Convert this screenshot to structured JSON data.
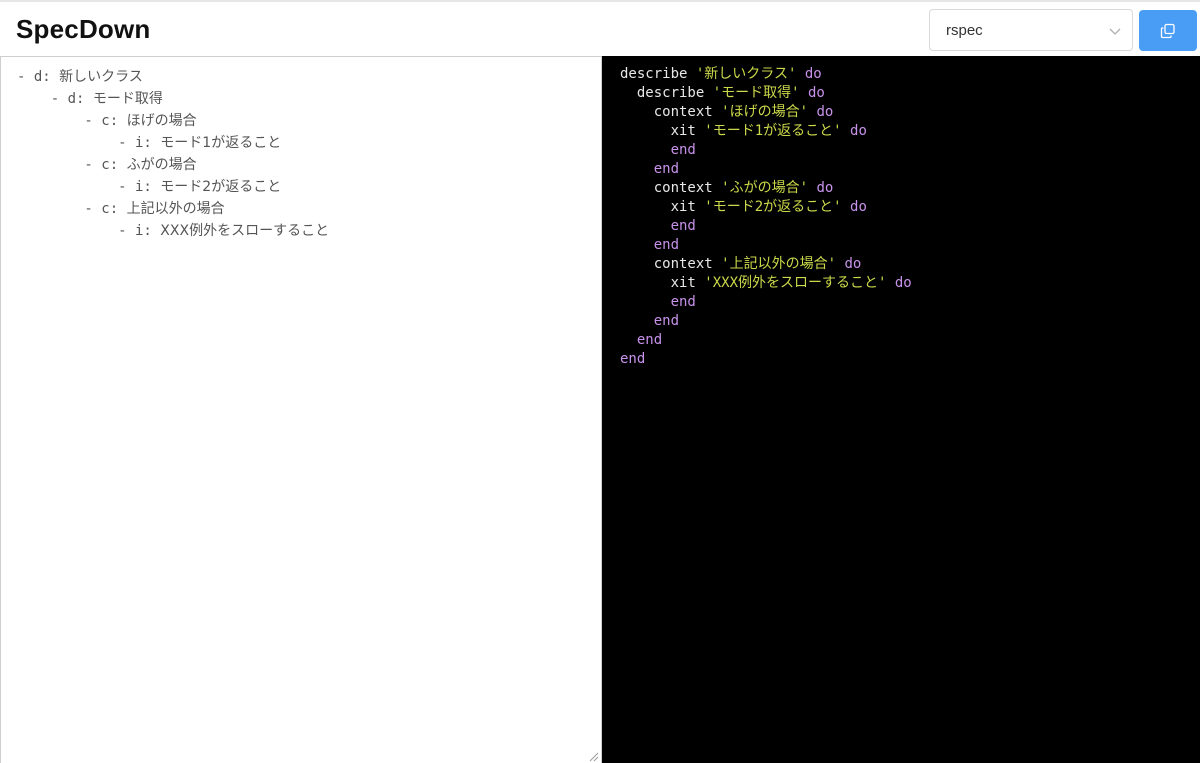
{
  "app": {
    "title": "SpecDown"
  },
  "toolbar": {
    "format_select": {
      "value": "rspec",
      "icon": "chevron-down-icon"
    },
    "copy_button": {
      "icon": "copy-icon",
      "color": "#4a9df5"
    }
  },
  "editor": {
    "lines": [
      {
        "prefix": "- d: ",
        "label": "新しいクラス"
      },
      {
        "prefix": "    - d: ",
        "label": "モード取得"
      },
      {
        "prefix": "        - c: ",
        "label": "ほげの場合"
      },
      {
        "prefix": "            - i: ",
        "label": "モード1が返ること"
      },
      {
        "prefix": "        - c: ",
        "label": "ふがの場合"
      },
      {
        "prefix": "            - i: ",
        "label": "モード2が返ること"
      },
      {
        "prefix": "        - c: ",
        "label": "上記以外の場合"
      },
      {
        "prefix": "            - i: ",
        "label": "XXX例外をスローすること"
      }
    ]
  },
  "output": {
    "colors": {
      "background": "#000000",
      "keyword": "#e8e8e8",
      "string": "#cbd94a",
      "do": "#c792ea"
    },
    "lines": [
      {
        "indent": "",
        "keyword": "describe ",
        "string": "'新しいクラス'",
        "suffix": " do"
      },
      {
        "indent": "  ",
        "keyword": "describe ",
        "string": "'モード取得'",
        "suffix": " do"
      },
      {
        "indent": "    ",
        "keyword": "context ",
        "string": "'ほげの場合'",
        "suffix": " do"
      },
      {
        "indent": "      ",
        "keyword": "xit ",
        "string": "'モード1が返ること'",
        "suffix": " do"
      },
      {
        "indent": "      ",
        "keyword": "",
        "string": "",
        "suffix": "end"
      },
      {
        "indent": "    ",
        "keyword": "",
        "string": "",
        "suffix": "end"
      },
      {
        "indent": "    ",
        "keyword": "context ",
        "string": "'ふがの場合'",
        "suffix": " do"
      },
      {
        "indent": "      ",
        "keyword": "xit ",
        "string": "'モード2が返ること'",
        "suffix": " do"
      },
      {
        "indent": "      ",
        "keyword": "",
        "string": "",
        "suffix": "end"
      },
      {
        "indent": "    ",
        "keyword": "",
        "string": "",
        "suffix": "end"
      },
      {
        "indent": "    ",
        "keyword": "context ",
        "string": "'上記以外の場合'",
        "suffix": " do"
      },
      {
        "indent": "      ",
        "keyword": "xit ",
        "string": "'XXX例外をスローすること'",
        "suffix": " do"
      },
      {
        "indent": "      ",
        "keyword": "",
        "string": "",
        "suffix": "end"
      },
      {
        "indent": "    ",
        "keyword": "",
        "string": "",
        "suffix": "end"
      },
      {
        "indent": "  ",
        "keyword": "",
        "string": "",
        "suffix": "end"
      },
      {
        "indent": "",
        "keyword": "",
        "string": "",
        "suffix": "end"
      }
    ]
  }
}
